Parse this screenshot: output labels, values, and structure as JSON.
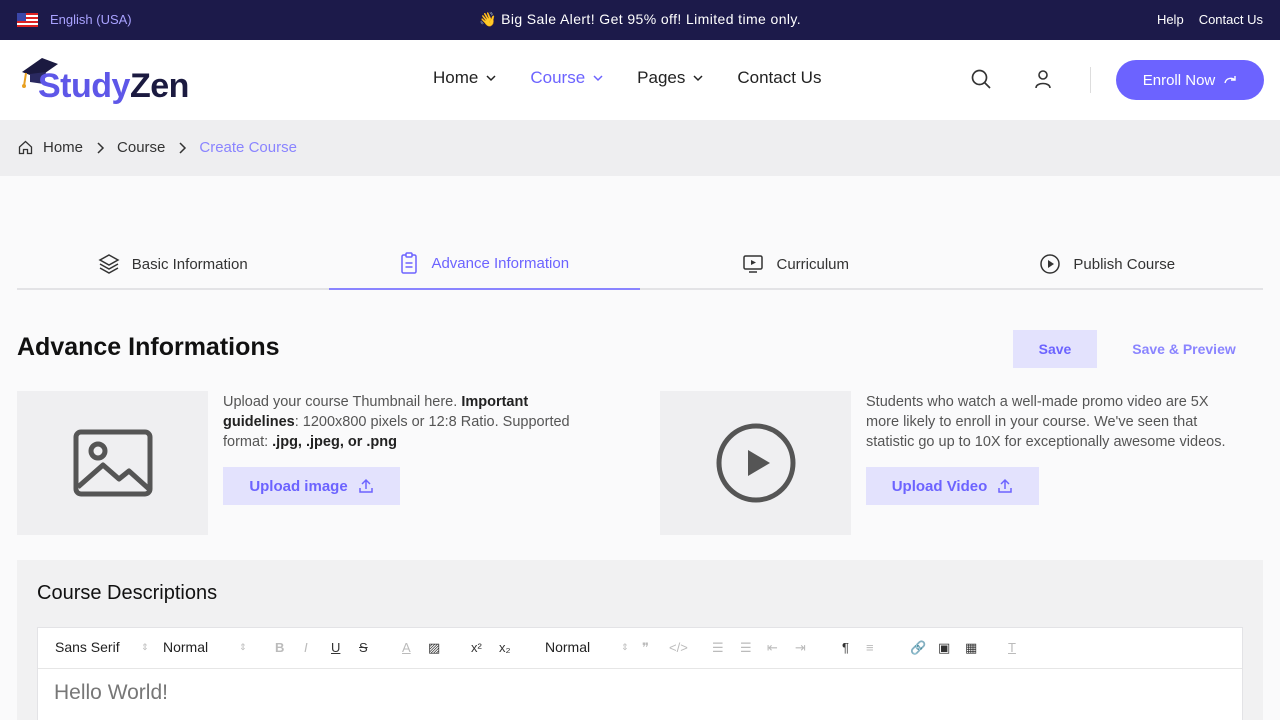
{
  "topbar": {
    "language": "English (USA)",
    "promo_emoji": "👋",
    "promo": "Big Sale Alert! Get 95% off! Limited time only.",
    "help": "Help",
    "contact": "Contact Us"
  },
  "header": {
    "logo_study": "Study",
    "logo_zen": "Zen",
    "nav": [
      {
        "label": "Home"
      },
      {
        "label": "Course"
      },
      {
        "label": "Pages"
      },
      {
        "label": "Contact Us"
      }
    ],
    "enroll": "Enroll Now"
  },
  "breadcrumb": {
    "home": "Home",
    "course": "Course",
    "current": "Create Course"
  },
  "tabs": [
    {
      "label": "Basic Information"
    },
    {
      "label": "Advance Information"
    },
    {
      "label": "Curriculum"
    },
    {
      "label": "Publish Course"
    }
  ],
  "section": {
    "title": "Advance Informations",
    "save": "Save",
    "save_preview": "Save & Preview"
  },
  "thumbnail": {
    "line1_pre": "Upload your course Thumbnail here. ",
    "line1_bold": "Important",
    "line2_bold": "guidelines",
    "line2_rest": ": 1200x800 pixels or 12:8 Ratio. Supported",
    "line3_pre": "format: ",
    "line3_bold": ".jpg, .jpeg, or .png",
    "button": "Upload image"
  },
  "video": {
    "line1": "Students who watch a well-made promo video are 5X",
    "line2": "more likely to enroll in your course. We've seen that",
    "line3": "statistic go up to 10X for exceptionally awesome videos.",
    "button": "Upload Video"
  },
  "description": {
    "title": "Course Descriptions",
    "font": "Sans Serif",
    "size": "Normal",
    "heading": "Normal",
    "content": "Hello World!"
  },
  "colors": {
    "accent": "#6c63ff",
    "topbar_bg": "#1c1a4a",
    "accent_light": "#e3e2fd"
  }
}
